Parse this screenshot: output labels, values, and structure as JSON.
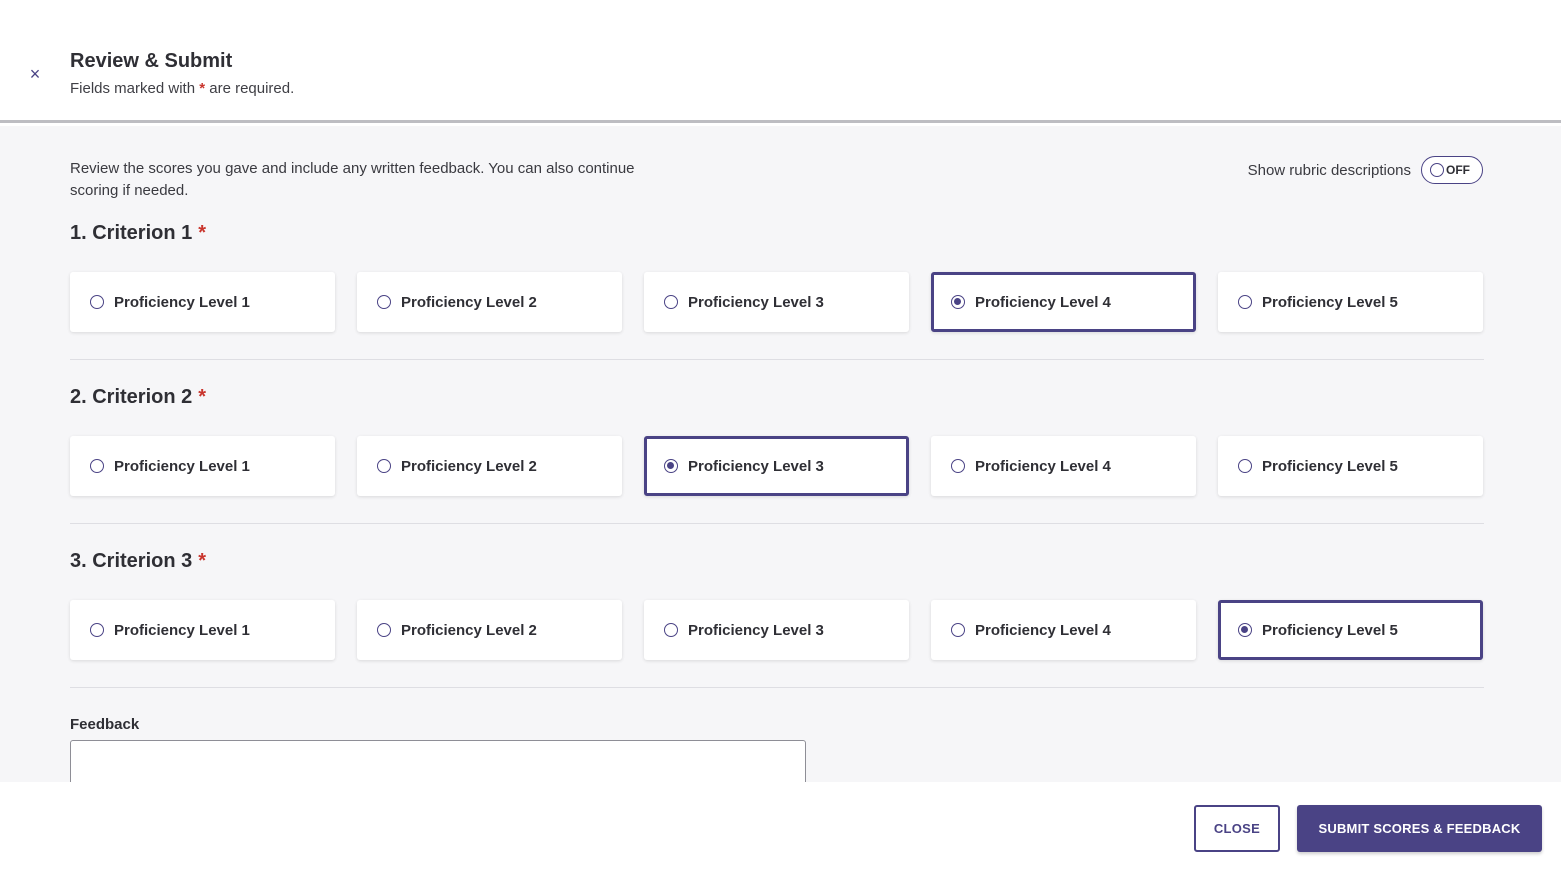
{
  "header": {
    "close_icon": "×",
    "title": "Review & Submit",
    "subtitle_prefix": "Fields marked with ",
    "required_marker": "*",
    "subtitle_suffix": " are required."
  },
  "intro": "Review the scores you gave and include any written feedback. You can also continue scoring if needed.",
  "rubric_toggle": {
    "label": "Show rubric descriptions",
    "state": "OFF"
  },
  "criteria": [
    {
      "title": "1. Criterion 1",
      "required": "*",
      "selected_index": 3,
      "options": [
        "Proficiency Level 1",
        "Proficiency Level 2",
        "Proficiency Level 3",
        "Proficiency Level 4",
        "Proficiency Level 5"
      ]
    },
    {
      "title": "2. Criterion 2",
      "required": "*",
      "selected_index": 2,
      "options": [
        "Proficiency Level 1",
        "Proficiency Level 2",
        "Proficiency Level 3",
        "Proficiency Level 4",
        "Proficiency Level 5"
      ]
    },
    {
      "title": "3. Criterion 3",
      "required": "*",
      "selected_index": 4,
      "options": [
        "Proficiency Level 1",
        "Proficiency Level 2",
        "Proficiency Level 3",
        "Proficiency Level 4",
        "Proficiency Level 5"
      ]
    }
  ],
  "feedback": {
    "label": "Feedback",
    "value": ""
  },
  "footer": {
    "close_label": "CLOSE",
    "submit_label": "SUBMIT SCORES & FEEDBACK"
  },
  "colors": {
    "accent": "#4a4385",
    "required": "#c9352d"
  }
}
